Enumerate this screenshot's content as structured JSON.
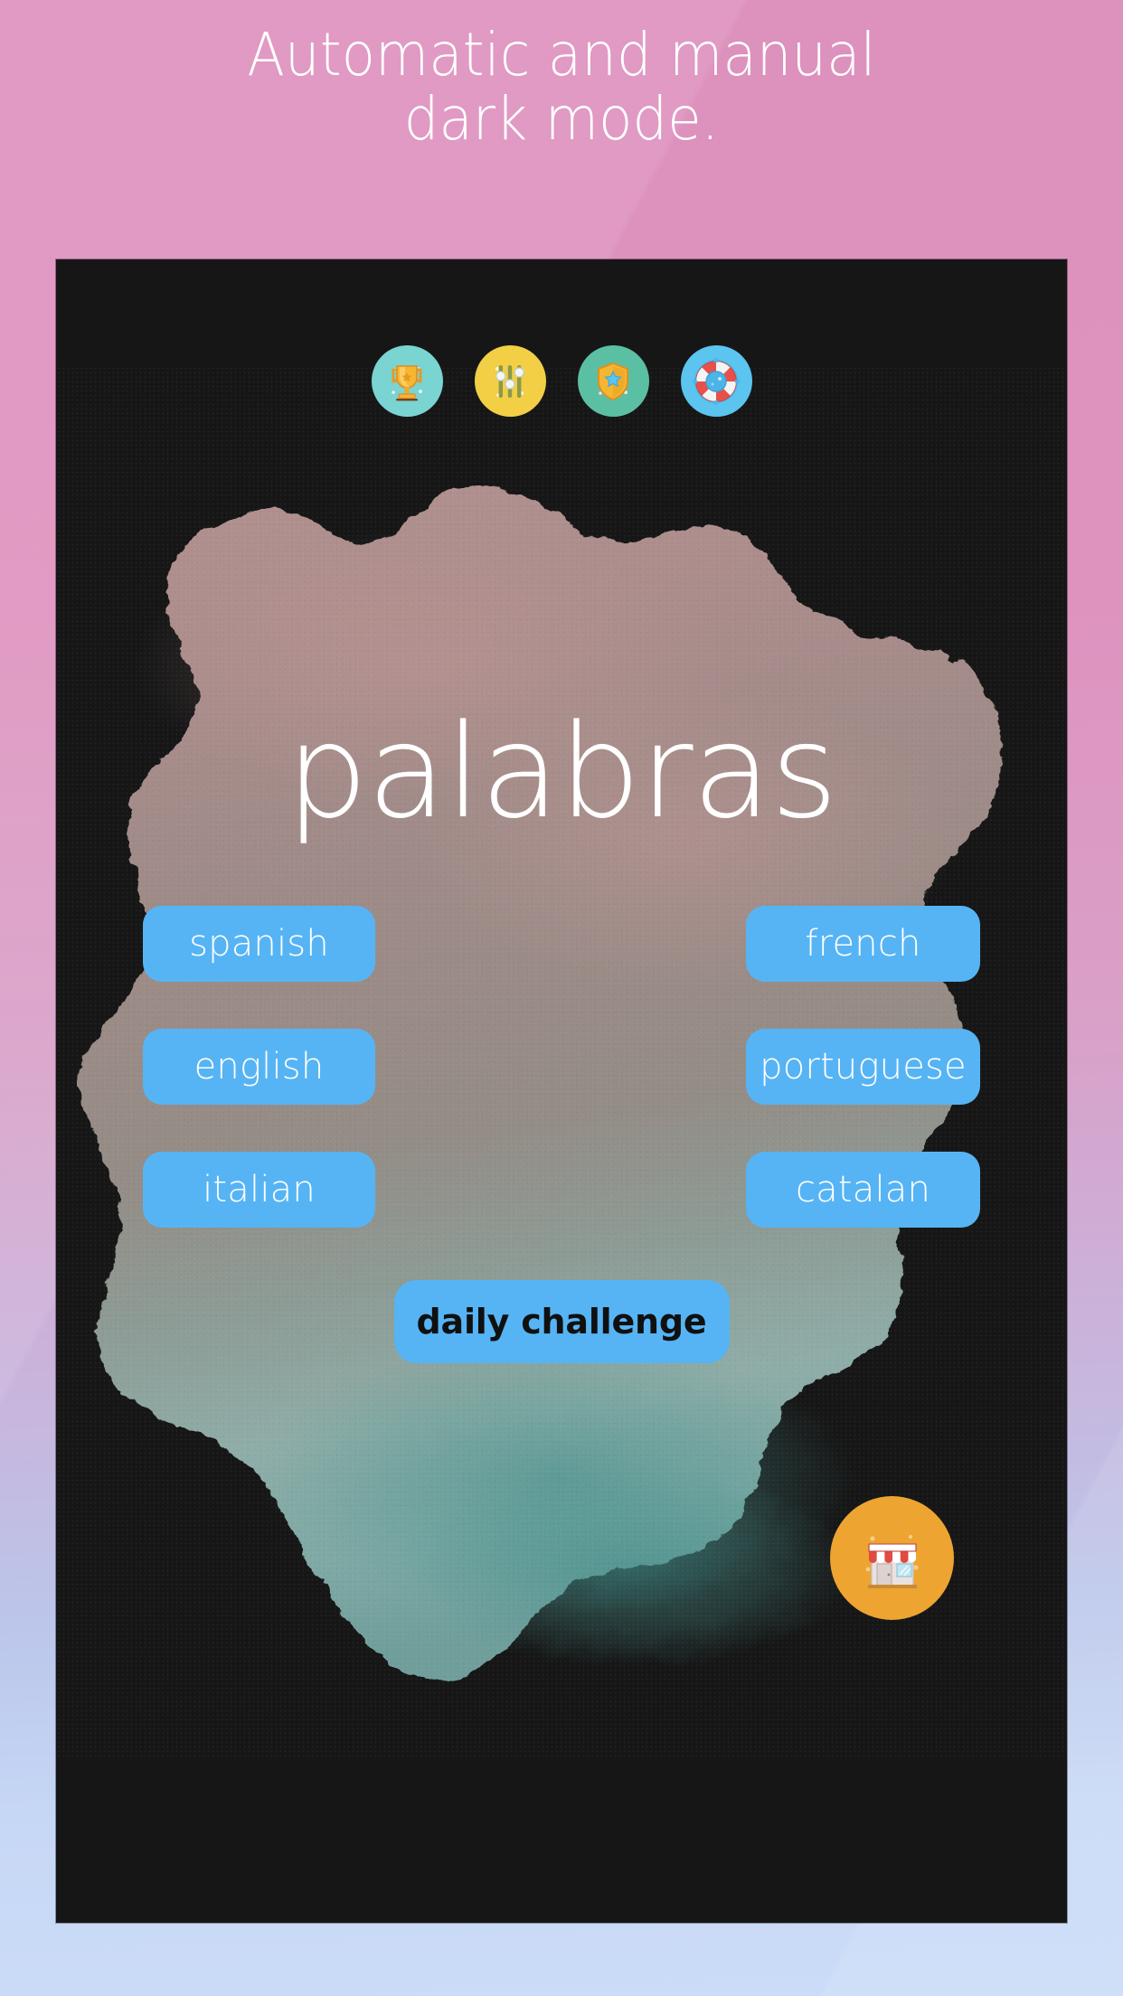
{
  "poster": {
    "headline_line1": "Automatic and manual",
    "headline_line2": "dark mode.",
    "background_colors": [
      "#dd91bd",
      "#cbdcf8"
    ],
    "headline_color": "#ffffff"
  },
  "app": {
    "frame_background": "#161616",
    "theme": "dark",
    "logo": "palabras",
    "logo_color": "#ffffff",
    "accent_color": "#56b4f4",
    "top_icons": [
      {
        "name": "trophy-icon",
        "label": "achievements",
        "bg": "#79d4d2"
      },
      {
        "name": "settings-icon",
        "label": "settings",
        "bg": "#f2cf45"
      },
      {
        "name": "badge-icon",
        "label": "badges",
        "bg": "#5bbfa3"
      },
      {
        "name": "help-icon",
        "label": "help",
        "bg": "#5bc4ef"
      }
    ],
    "languages": [
      {
        "label": "spanish"
      },
      {
        "label": "french"
      },
      {
        "label": "english"
      },
      {
        "label": "portuguese"
      },
      {
        "label": "italian"
      },
      {
        "label": "catalan"
      }
    ],
    "daily_challenge_label": "daily challenge",
    "shop": {
      "name": "shop-icon",
      "label": "shop",
      "bg": "#eda430"
    },
    "blob": {
      "top_color": "#a98d8b",
      "mid_color": "#9c8c89",
      "bottom_color": "#8fada8"
    }
  }
}
